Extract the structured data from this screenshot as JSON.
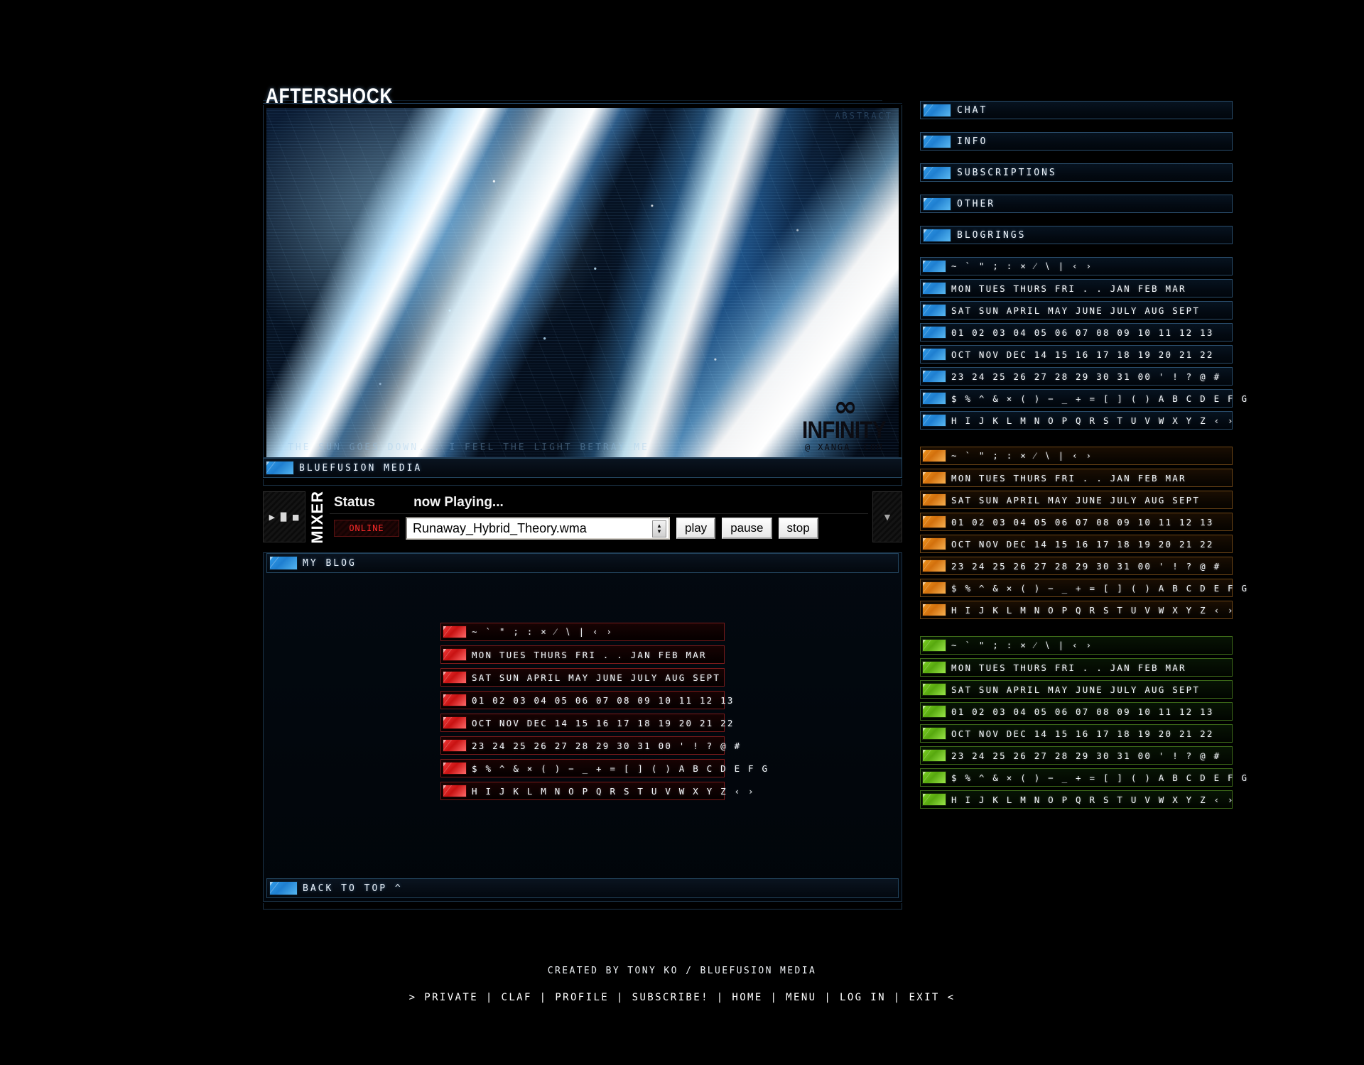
{
  "brand": {
    "title": "AFTERSHOCK"
  },
  "hero": {
    "label": "ABSTRACT",
    "caption": "THE SUN GOES DOWN... I FEEL THE LIGHT BETRAY ME",
    "logo_mark": "∞",
    "logo_word": "INFINITY",
    "logo_sub": "@ XANGA .COM"
  },
  "media_bar": {
    "label": "BLUEFUSION MEDIA"
  },
  "mixer": {
    "vertical_label": "MIXER",
    "status_label": "Status",
    "now_playing_label": "now Playing...",
    "online_badge": "ONLINE",
    "track_value": "Runaway_Hybrid_Theory.wma",
    "buttons": [
      "play",
      "pause",
      "stop"
    ],
    "transport_glyphs": "▶ ▐▌ ■",
    "scroll_glyph": "▼"
  },
  "blog": {
    "header": "MY BLOG",
    "footer_link": "BACK TO TOP ^",
    "rows": [
      "∼ ` \" ; : × ⁄ ∖ | ‹ ›",
      "MON TUES THURS FRI . . JAN FEB MAR",
      "SAT SUN APRIL MAY JUNE JULY AUG SEPT",
      "01 02 03 04 05 06 07 08 09 10 11 12 13",
      "OCT NOV DEC 14 15 16 17 18 19 20 21 22",
      "23 24 25 26 27 28 29 30 31 00 ' ! ? @ #",
      "$ % ^ & × ( ) − _ + = [ ] ( ) A B C D E F G",
      "H I J K L M N O P Q R S T U V W X Y Z ‹ ›"
    ]
  },
  "sidebar": {
    "nav": [
      {
        "label": "CHAT"
      },
      {
        "label": "INFO"
      },
      {
        "label": "SUBSCRIPTIONS"
      },
      {
        "label": "OTHER"
      },
      {
        "label": "BLOGRINGS"
      }
    ],
    "groups": [
      {
        "theme": "blue",
        "accent": "#2f9ae8",
        "rows": [
          "∼ ` \" ; : × ⁄ ∖ | ‹ ›",
          "MON TUES THURS FRI . . JAN FEB MAR",
          "SAT SUN APRIL MAY JUNE JULY AUG SEPT",
          "01 02 03 04 05 06 07 08 09 10 11 12 13",
          "OCT NOV DEC 14 15 16 17 18 19 20 21 22",
          "23 24 25 26 27 28 29 30 31 00 ' ! ? @ #",
          "$ % ^ & × ( ) − _ + = [ ] ( ) A B C D E F G",
          "H I J K L M N O P Q R S T U V W X Y Z ‹ ›"
        ]
      },
      {
        "theme": "orange",
        "accent": "#f0951f",
        "rows": [
          "∼ ` \" ; : × ⁄ ∖ | ‹ ›",
          "MON TUES THURS FRI . . JAN FEB MAR",
          "SAT SUN APRIL MAY JUNE JULY AUG SEPT",
          "01 02 03 04 05 06 07 08 09 10 11 12 13",
          "OCT NOV DEC 14 15 16 17 18 19 20 21 22",
          "23 24 25 26 27 28 29 30 31 00 ' ! ? @ #",
          "$ % ^ & × ( ) − _ + = [ ] ( ) A B C D E F G",
          "H I J K L M N O P Q R S T U V W X Y Z ‹ ›"
        ]
      },
      {
        "theme": "green",
        "accent": "#7bd122",
        "rows": [
          "∼ ` \" ; : × ⁄ ∖ | ‹ ›",
          "MON TUES THURS FRI . . JAN FEB MAR",
          "SAT SUN APRIL MAY JUNE JULY AUG SEPT",
          "01 02 03 04 05 06 07 08 09 10 11 12 13",
          "OCT NOV DEC 14 15 16 17 18 19 20 21 22",
          "23 24 25 26 27 28 29 30 31 00 ' ! ? @ #",
          "$ % ^ & × ( ) − _ + = [ ] ( ) A B C D E F G",
          "H I J K L M N O P Q R S T U V W X Y Z ‹ ›"
        ]
      }
    ]
  },
  "blog_theme": {
    "theme": "red",
    "accent": "#f23a3a"
  },
  "footer": {
    "credit": "CREATED BY TONY KO / BLUEFUSION MEDIA",
    "links": "> PRIVATE | CLAF | PROFILE | SUBSCRIBE! | HOME | MENU | LOG IN | EXIT <"
  }
}
